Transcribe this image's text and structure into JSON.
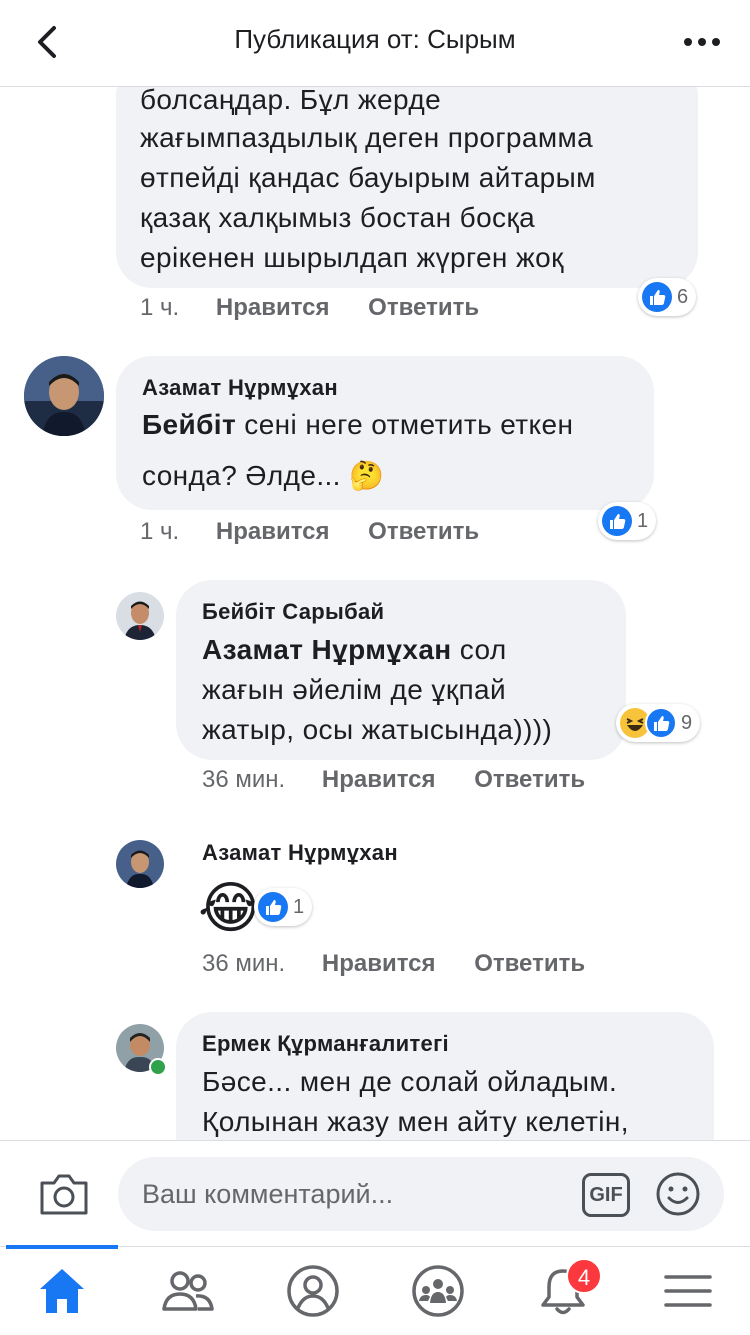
{
  "header": {
    "title": "Публикация от: Сырым"
  },
  "comments": [
    {
      "lines": [
        "болсаңдар. Бұл жерде",
        "жағымпаздылық деген программа",
        "өтпейді қандас бауырым айтарым",
        "қазақ халқымыз бостан босқа",
        "ерікенен шырылдап жүрген жоқ"
      ],
      "time": "1 ч.",
      "like_label": "Нравится",
      "reply_label": "Ответить",
      "reactions": "6"
    },
    {
      "author": "Азамат Нұрмұхан",
      "mention": "Бейбіт",
      "line1_rest": " сені неге отметить еткен",
      "line2": "сонда? Әлде... 🤔",
      "time": "1 ч.",
      "like_label": "Нравится",
      "reply_label": "Ответить",
      "reactions": "1"
    },
    {
      "author": "Бейбіт Сарыбай",
      "mention": "Азамат Нұрмұхан",
      "line1_rest": " сол",
      "line2": "жағын әйелім де ұқпай",
      "line3": "жатыр, осы жатысында))))",
      "time": "36 мин.",
      "like_label": "Нравится",
      "reply_label": "Ответить",
      "reactions": "9"
    },
    {
      "author": "Азамат Нұрмұхан",
      "emoji": "😂",
      "time": "36 мин.",
      "like_label": "Нравится",
      "reply_label": "Ответить",
      "reactions": "1"
    },
    {
      "author": "Ермек Құрманғалитегі",
      "line1": "Бәсе... мен де солай ойладым.",
      "line2": "Қолынан жазу мен айту келетін,"
    }
  ],
  "composer": {
    "placeholder": "Ваш комментарий...",
    "gif_label": "GIF"
  },
  "tabbar": {
    "notifications_count": "4"
  },
  "colors": {
    "accent": "#1877f2",
    "bubble": "#f0f2f5",
    "meta": "#65676b",
    "badge": "#fa383e",
    "online": "#31a24c"
  }
}
